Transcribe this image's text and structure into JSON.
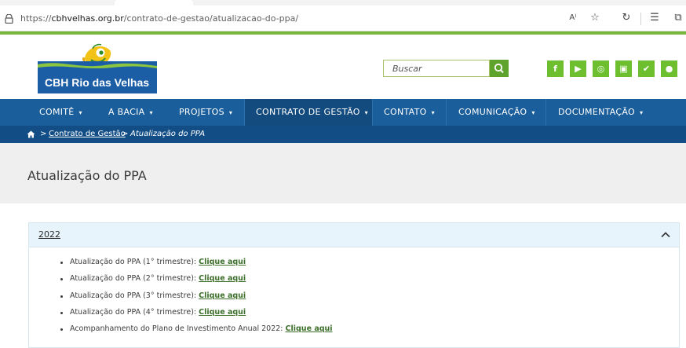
{
  "browser": {
    "url_prefix": "https://",
    "url_host": "cbhvelhas.org.br",
    "url_path": "/contrato-de-gestao/atualizacao-do-ppa/",
    "read_aloud_label": "A⁾"
  },
  "header": {
    "logo_text": "CBH Rio das Velhas",
    "search_placeholder": "Buscar",
    "social": [
      {
        "name": "facebook",
        "glyph": "f"
      },
      {
        "name": "youtube",
        "glyph": "▶"
      },
      {
        "name": "instagram",
        "glyph": "◎"
      },
      {
        "name": "flickr",
        "glyph": "▣"
      },
      {
        "name": "twitter",
        "glyph": "✔"
      },
      {
        "name": "spotify",
        "glyph": "●"
      }
    ]
  },
  "nav": {
    "items": [
      {
        "label": "COMITÊ"
      },
      {
        "label": "A BACIA"
      },
      {
        "label": "PROJETOS"
      },
      {
        "label": "CONTRATO DE GESTÃO",
        "active": true
      },
      {
        "label": "CONTATO"
      },
      {
        "label": "COMUNICAÇÃO"
      },
      {
        "label": "DOCUMENTAÇÃO"
      }
    ],
    "caret": "▾"
  },
  "breadcrumb": {
    "separator": ">",
    "parent": "Contrato de Gestão",
    "current": "Atualização do PPA"
  },
  "page": {
    "title": "Atualização do PPA"
  },
  "accordion": {
    "year": "2022",
    "expanded": true,
    "items": [
      {
        "text": "Atualização do PPA (1° trimestre): ",
        "link": "Clique aqui"
      },
      {
        "text": "Atualização do PPA (2° trimestre): ",
        "link": "Clique aqui"
      },
      {
        "text": "Atualização do PPA (3° trimestre): ",
        "link": "Clique aqui"
      },
      {
        "text": "Atualização do PPA (4° trimestre): ",
        "link": "Clique aqui"
      },
      {
        "text": "Acompanhamento do Plano de Investimento Anual 2022: ",
        "link": "Clique aqui"
      }
    ]
  },
  "colors": {
    "nav_bg": "#1a5e9c",
    "nav_active": "#134b7f",
    "breadcrumb_bg": "#124d86",
    "green_accent": "#78b53c",
    "social_bg": "#6dbf2f",
    "link_green": "#3c6e2a"
  }
}
